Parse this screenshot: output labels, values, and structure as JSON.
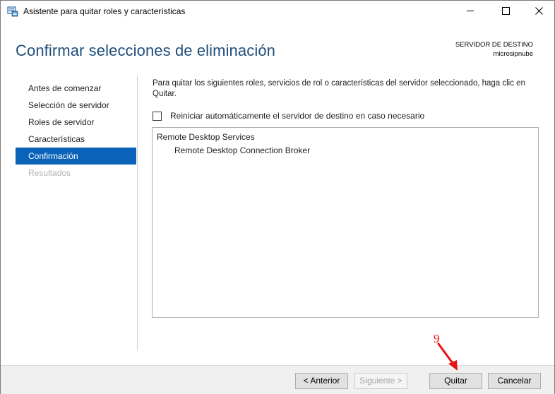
{
  "window": {
    "title": "Asistente para quitar roles y características",
    "icons": {
      "app": "server-manager-icon",
      "minimize": "minimize-icon",
      "maximize": "maximize-icon",
      "close": "close-icon"
    }
  },
  "header": {
    "page_title": "Confirmar selecciones de eliminación",
    "destination_label": "SERVIDOR DE DESTINO",
    "destination_server": "microsipnube"
  },
  "nav": {
    "items": [
      {
        "label": "Antes de comenzar",
        "state": "normal"
      },
      {
        "label": "Selección de servidor",
        "state": "normal"
      },
      {
        "label": "Roles de servidor",
        "state": "normal"
      },
      {
        "label": "Características",
        "state": "normal"
      },
      {
        "label": "Confirmación",
        "state": "active"
      },
      {
        "label": "Resultados",
        "state": "disabled"
      }
    ]
  },
  "content": {
    "description": "Para quitar los siguientes roles, servicios de rol o características del servidor seleccionado, haga clic en Quitar.",
    "restart_checkbox": {
      "label": "Reiniciar automáticamente el servidor de destino en caso necesario",
      "checked": false
    },
    "items": [
      {
        "text": "Remote Desktop Services",
        "level": 0
      },
      {
        "text": "Remote Desktop Connection Broker",
        "level": 1
      }
    ]
  },
  "footer": {
    "previous_label": "< Anterior",
    "next_label": "Siguiente >",
    "remove_label": "Quitar",
    "cancel_label": "Cancelar"
  },
  "annotation": {
    "step_number": "9",
    "color": "#e81313"
  },
  "colors": {
    "title_blue": "#1e4e79",
    "nav_active": "#0a63b8"
  }
}
